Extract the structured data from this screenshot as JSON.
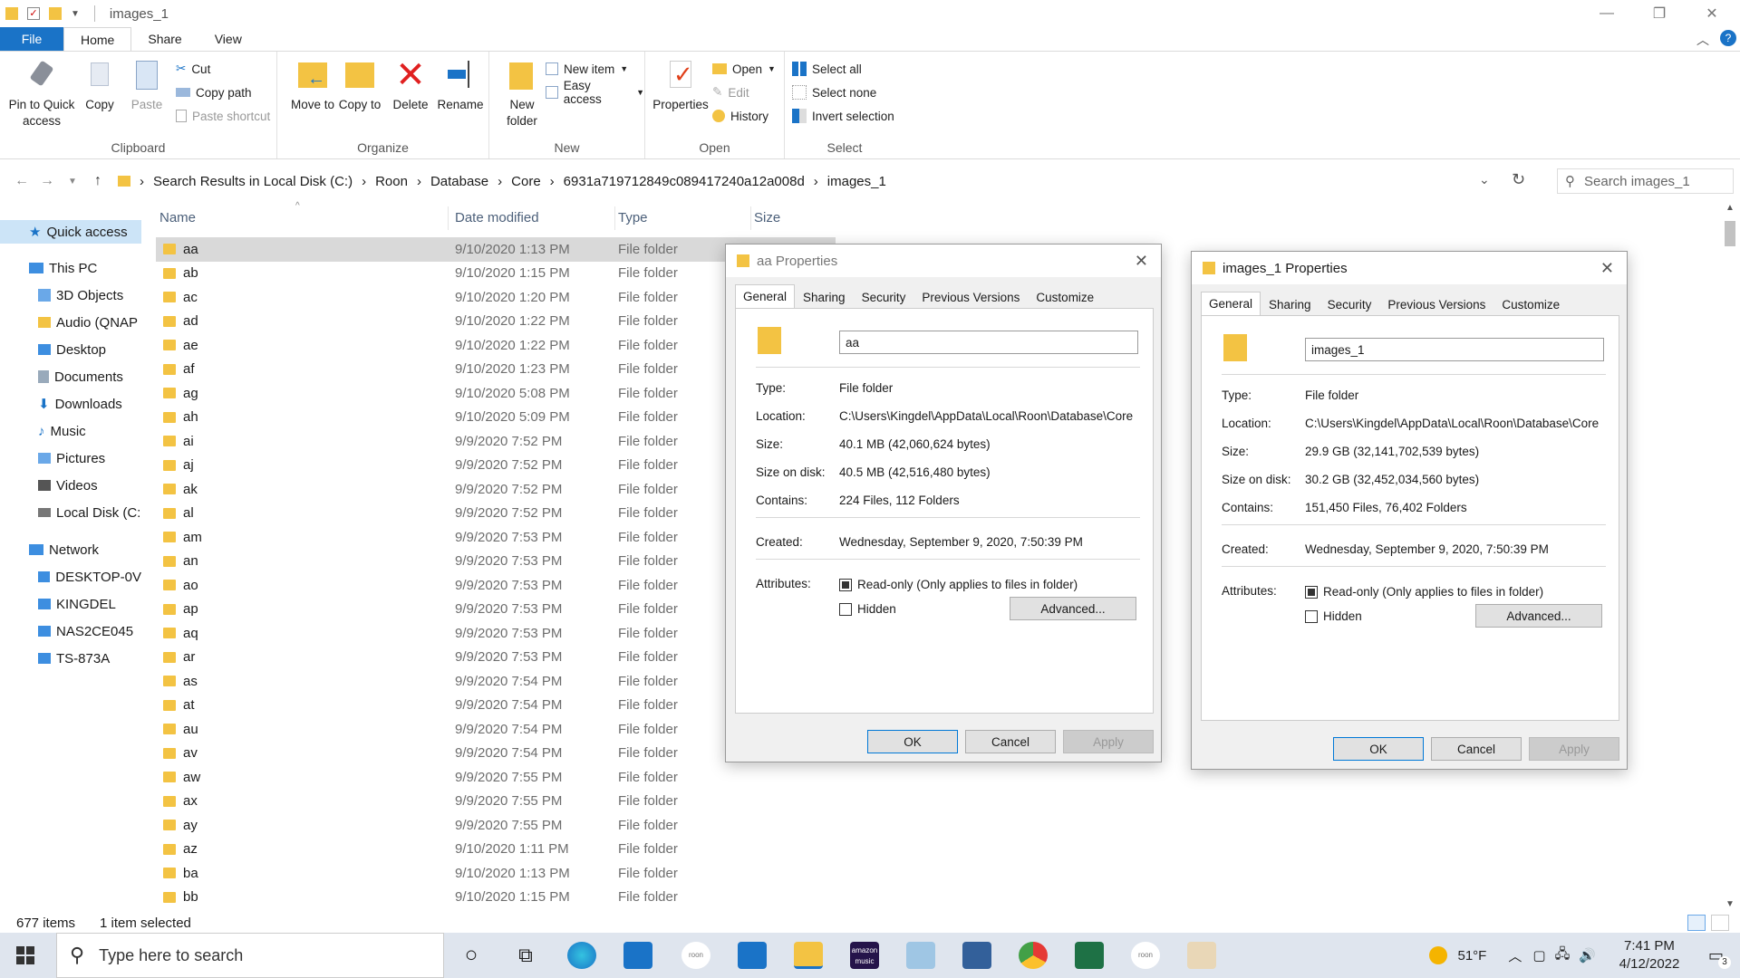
{
  "window": {
    "title": "images_1"
  },
  "ribbon_tabs": [
    "File",
    "Home",
    "Share",
    "View"
  ],
  "ribbon": {
    "clipboard": {
      "pin": "Pin to Quick access",
      "copy": "Copy",
      "paste": "Paste",
      "cut": "Cut",
      "copy_path": "Copy path",
      "paste_shortcut": "Paste shortcut",
      "label": "Clipboard"
    },
    "organize": {
      "move_to": "Move to",
      "copy_to": "Copy to",
      "delete": "Delete",
      "rename": "Rename",
      "label": "Organize"
    },
    "new": {
      "new_folder": "New folder",
      "new_item": "New item",
      "easy_access": "Easy access",
      "label": "New"
    },
    "open": {
      "properties": "Properties",
      "open": "Open",
      "edit": "Edit",
      "history": "History",
      "label": "Open"
    },
    "select": {
      "select_all": "Select all",
      "select_none": "Select none",
      "invert": "Invert selection",
      "label": "Select"
    }
  },
  "address": {
    "crumbs": [
      "Search Results in Local Disk (C:)",
      "Roon",
      "Database",
      "Core",
      "6931a719712849c089417240a12a008d",
      "images_1"
    ],
    "search_placeholder": "Search images_1"
  },
  "nav": [
    {
      "label": "Quick access",
      "icon": "star-icon",
      "selected": true
    },
    {
      "label": "This PC",
      "icon": "pc-icon"
    },
    {
      "label": "3D Objects",
      "icon": "cube-icon"
    },
    {
      "label": "Audio (QNAP",
      "icon": "drive-icon"
    },
    {
      "label": "Desktop",
      "icon": "desktop-icon"
    },
    {
      "label": "Documents",
      "icon": "document-icon"
    },
    {
      "label": "Downloads",
      "icon": "download-icon"
    },
    {
      "label": "Music",
      "icon": "music-icon"
    },
    {
      "label": "Pictures",
      "icon": "picture-icon"
    },
    {
      "label": "Videos",
      "icon": "video-icon"
    },
    {
      "label": "Local Disk (C:",
      "icon": "drive-icon"
    },
    {
      "label": "Network",
      "icon": "network-icon"
    },
    {
      "label": "DESKTOP-0V",
      "icon": "computer-icon"
    },
    {
      "label": "KINGDEL",
      "icon": "computer-icon"
    },
    {
      "label": "NAS2CE045",
      "icon": "computer-icon"
    },
    {
      "label": "TS-873A",
      "icon": "computer-icon"
    }
  ],
  "columns": {
    "name": "Name",
    "date": "Date modified",
    "type": "Type",
    "size": "Size"
  },
  "files": [
    {
      "name": "aa",
      "date": "9/10/2020 1:13 PM",
      "type": "File folder"
    },
    {
      "name": "ab",
      "date": "9/10/2020 1:15 PM",
      "type": "File folder"
    },
    {
      "name": "ac",
      "date": "9/10/2020 1:20 PM",
      "type": "File folder"
    },
    {
      "name": "ad",
      "date": "9/10/2020 1:22 PM",
      "type": "File folder"
    },
    {
      "name": "ae",
      "date": "9/10/2020 1:22 PM",
      "type": "File folder"
    },
    {
      "name": "af",
      "date": "9/10/2020 1:23 PM",
      "type": "File folder"
    },
    {
      "name": "ag",
      "date": "9/10/2020 5:08 PM",
      "type": "File folder"
    },
    {
      "name": "ah",
      "date": "9/10/2020 5:09 PM",
      "type": "File folder"
    },
    {
      "name": "ai",
      "date": "9/9/2020 7:52 PM",
      "type": "File folder"
    },
    {
      "name": "aj",
      "date": "9/9/2020 7:52 PM",
      "type": "File folder"
    },
    {
      "name": "ak",
      "date": "9/9/2020 7:52 PM",
      "type": "File folder"
    },
    {
      "name": "al",
      "date": "9/9/2020 7:52 PM",
      "type": "File folder"
    },
    {
      "name": "am",
      "date": "9/9/2020 7:53 PM",
      "type": "File folder"
    },
    {
      "name": "an",
      "date": "9/9/2020 7:53 PM",
      "type": "File folder"
    },
    {
      "name": "ao",
      "date": "9/9/2020 7:53 PM",
      "type": "File folder"
    },
    {
      "name": "ap",
      "date": "9/9/2020 7:53 PM",
      "type": "File folder"
    },
    {
      "name": "aq",
      "date": "9/9/2020 7:53 PM",
      "type": "File folder"
    },
    {
      "name": "ar",
      "date": "9/9/2020 7:53 PM",
      "type": "File folder"
    },
    {
      "name": "as",
      "date": "9/9/2020 7:54 PM",
      "type": "File folder"
    },
    {
      "name": "at",
      "date": "9/9/2020 7:54 PM",
      "type": "File folder"
    },
    {
      "name": "au",
      "date": "9/9/2020 7:54 PM",
      "type": "File folder"
    },
    {
      "name": "av",
      "date": "9/9/2020 7:54 PM",
      "type": "File folder"
    },
    {
      "name": "aw",
      "date": "9/9/2020 7:55 PM",
      "type": "File folder"
    },
    {
      "name": "ax",
      "date": "9/9/2020 7:55 PM",
      "type": "File folder"
    },
    {
      "name": "ay",
      "date": "9/9/2020 7:55 PM",
      "type": "File folder"
    },
    {
      "name": "az",
      "date": "9/10/2020 1:11 PM",
      "type": "File folder"
    },
    {
      "name": "ba",
      "date": "9/10/2020 1:13 PM",
      "type": "File folder"
    },
    {
      "name": "bb",
      "date": "9/10/2020 1:15 PM",
      "type": "File folder"
    }
  ],
  "status": {
    "items": "677 items",
    "selected": "1 item selected"
  },
  "dialog_aa": {
    "title": "aa Properties",
    "tabs": [
      "General",
      "Sharing",
      "Security",
      "Previous Versions",
      "Customize"
    ],
    "name": "aa",
    "type_label": "Type:",
    "type": "File folder",
    "location_label": "Location:",
    "location": "C:\\Users\\Kingdel\\AppData\\Local\\Roon\\Database\\Core",
    "size_label": "Size:",
    "size": "40.1 MB (42,060,624 bytes)",
    "disk_label": "Size on disk:",
    "disk": "40.5 MB (42,516,480 bytes)",
    "contains_label": "Contains:",
    "contains": "224 Files, 112 Folders",
    "created_label": "Created:",
    "created": "Wednesday, September 9, 2020, 7:50:39 PM",
    "attr_label": "Attributes:",
    "readonly": "Read-only (Only applies to files in folder)",
    "hidden": "Hidden",
    "advanced": "Advanced...",
    "ok": "OK",
    "cancel": "Cancel",
    "apply": "Apply"
  },
  "dialog_images": {
    "title": "images_1 Properties",
    "tabs": [
      "General",
      "Sharing",
      "Security",
      "Previous Versions",
      "Customize"
    ],
    "name": "images_1",
    "type_label": "Type:",
    "type": "File folder",
    "location_label": "Location:",
    "location": "C:\\Users\\Kingdel\\AppData\\Local\\Roon\\Database\\Core",
    "size_label": "Size:",
    "size": "29.9 GB (32,141,702,539 bytes)",
    "disk_label": "Size on disk:",
    "disk": "30.2 GB (32,452,034,560 bytes)",
    "contains_label": "Contains:",
    "contains": "151,450 Files, 76,402 Folders",
    "created_label": "Created:",
    "created": "Wednesday, September 9, 2020, 7:50:39 PM",
    "attr_label": "Attributes:",
    "readonly": "Read-only (Only applies to files in folder)",
    "hidden": "Hidden",
    "advanced": "Advanced...",
    "ok": "OK",
    "cancel": "Cancel",
    "apply": "Apply"
  },
  "taskbar": {
    "search_placeholder": "Type here to search",
    "temp": "51°F",
    "time": "7:41 PM",
    "date": "4/12/2022",
    "notif_count": "3",
    "roon_label": "roon",
    "amazon_label": "amazon music"
  },
  "colors": {
    "accent": "#1a73c7",
    "folder": "#f3c343",
    "selection": "#cce4f7"
  }
}
